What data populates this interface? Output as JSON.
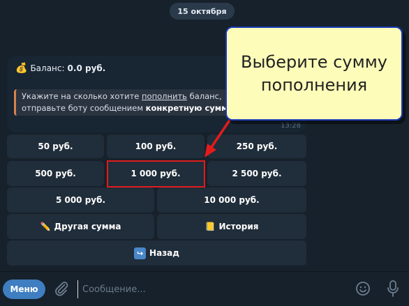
{
  "chat": {
    "date": "15 октября",
    "message": {
      "balance_icon": "💰",
      "balance_label": "Баланс:",
      "balance_value": "0.0 руб.",
      "quote_line1_prefix": "Укажите на сколько хотите ",
      "quote_line1_link": "пополнить",
      "quote_line1_suffix": " баланс,",
      "quote_line2_prefix": "отправьте боту сообщением ",
      "quote_line2_bold": "конкретную сумм",
      "time": "13:28"
    }
  },
  "keyboard": {
    "amount_50": "50 руб.",
    "amount_100": "100 руб.",
    "amount_250": "250 руб.",
    "amount_500": "500 руб.",
    "amount_1000": "1 000 руб.",
    "amount_2500": "2 500 руб.",
    "amount_5000": "5 000 руб.",
    "amount_10000": "10 000 руб.",
    "other_icon": "✏️",
    "other_label": "Другая сумма",
    "history_icon": "📒",
    "history_label": "История",
    "back_icon": "↪",
    "back_label": "Назад"
  },
  "annotation": {
    "callout_text": "Выберите сумму пополнения",
    "highlight_color": "#e21c1c",
    "callout_border_color": "#1c3bb8",
    "callout_fill_color": "#fdfdb9"
  },
  "input_bar": {
    "menu_label": "Меню",
    "placeholder": "Сообщение...",
    "attach_icon": "paperclip-icon",
    "emoji_icon": "smile-icon",
    "mic_icon": "microphone-icon"
  },
  "colors": {
    "background": "#17212b",
    "button_bg": "#202d3a",
    "menu_button": "#3e7ec1",
    "quote_border": "#d8834c"
  }
}
